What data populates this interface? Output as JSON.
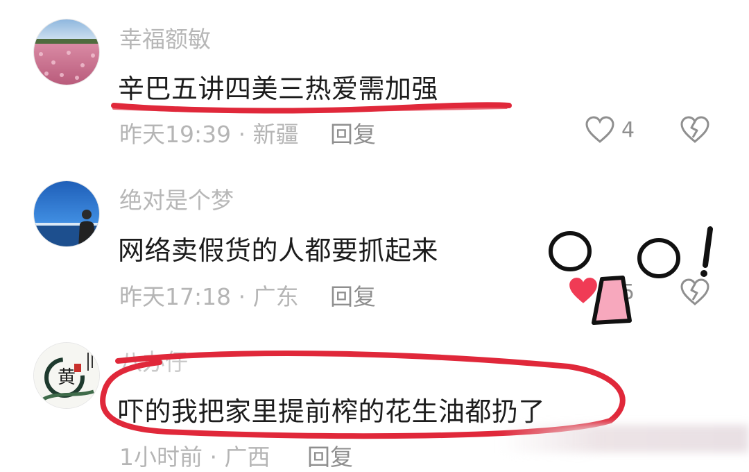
{
  "comments": [
    {
      "username": "幸福额敏",
      "text": "辛巴五讲四美三热爱需加强",
      "time_location": "昨天19:39 · 新疆",
      "reply_label": "回复",
      "like_count": "4",
      "avatar_icon": "flower-field-avatar"
    },
    {
      "username": "绝对是个梦",
      "text": "网络卖假货的人都要抓起来",
      "time_location": "昨天17:18 · 广东",
      "reply_label": "回复",
      "like_count": "5",
      "avatar_icon": "seaside-person-avatar"
    },
    {
      "username": "八办仔",
      "text": "吓的我把家里提前榨的花生油都扔了",
      "time_location": "1小时前 · 广西",
      "reply_label": "回复",
      "avatar_icon": "calligraphy-seal-avatar"
    }
  ],
  "colors": {
    "underline": "#e0283a",
    "like_active": "#f03b55"
  }
}
